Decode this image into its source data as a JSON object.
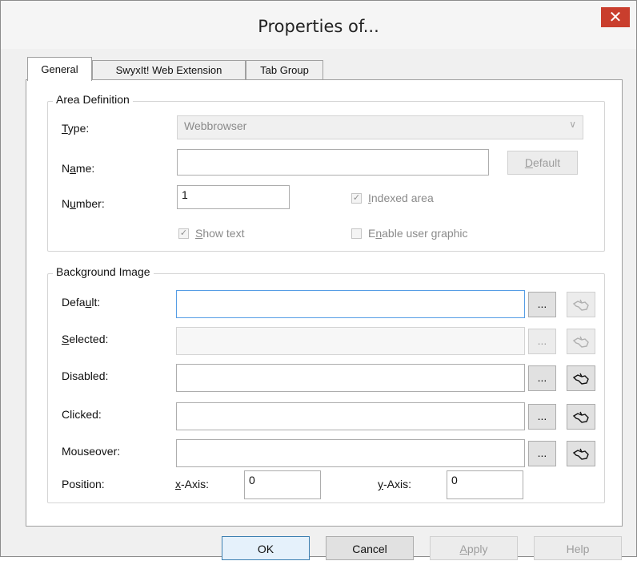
{
  "window": {
    "title": "Properties of...",
    "close_glyph": "✕"
  },
  "tabs": [
    {
      "label": "General",
      "active": true
    },
    {
      "label": "SwyxIt! Web Extension",
      "active": false
    },
    {
      "label": "Tab Group",
      "active": false
    }
  ],
  "area_definition": {
    "legend": "Area Definition",
    "type_label": "Type:",
    "type_value": "Webbrowser",
    "name_label": "Name:",
    "name_value": "",
    "default_button": "Default",
    "number_label": "Number:",
    "number_value": "1",
    "indexed_area": {
      "label": "Indexed area",
      "checked": true,
      "enabled": false
    },
    "show_text": {
      "label": "Show text",
      "checked": true,
      "enabled": false
    },
    "enable_user_graphic": {
      "label": "Enable user graphic",
      "checked": false,
      "enabled": false
    }
  },
  "background_image": {
    "legend": "Background Image",
    "rows": [
      {
        "label": "Default:",
        "value": "",
        "enabled": true,
        "browse": "...",
        "icon": "hand-pointer-icon"
      },
      {
        "label": "Selected:",
        "value": "",
        "enabled": false,
        "browse": "...",
        "icon": "hand-pointer-icon"
      },
      {
        "label": "Disabled:",
        "value": "",
        "enabled": true,
        "browse": "...",
        "icon": "hand-pointer-icon"
      },
      {
        "label": "Clicked:",
        "value": "",
        "enabled": true,
        "browse": "...",
        "icon": "hand-pointer-icon"
      },
      {
        "label": "Mouseover:",
        "value": "",
        "enabled": true,
        "browse": "...",
        "icon": "hand-pointer-icon"
      }
    ],
    "position_label": "Position:",
    "x_axis_label": "x-Axis:",
    "x_axis_value": "0",
    "y_axis_label": "y-Axis:",
    "y_axis_value": "0"
  },
  "footer": {
    "ok": "OK",
    "cancel": "Cancel",
    "apply": "Apply",
    "help": "Help"
  },
  "colors": {
    "close_button": "#c93e2d",
    "focus_border": "#569de5",
    "dialog_bg": "#f0f0f0"
  }
}
